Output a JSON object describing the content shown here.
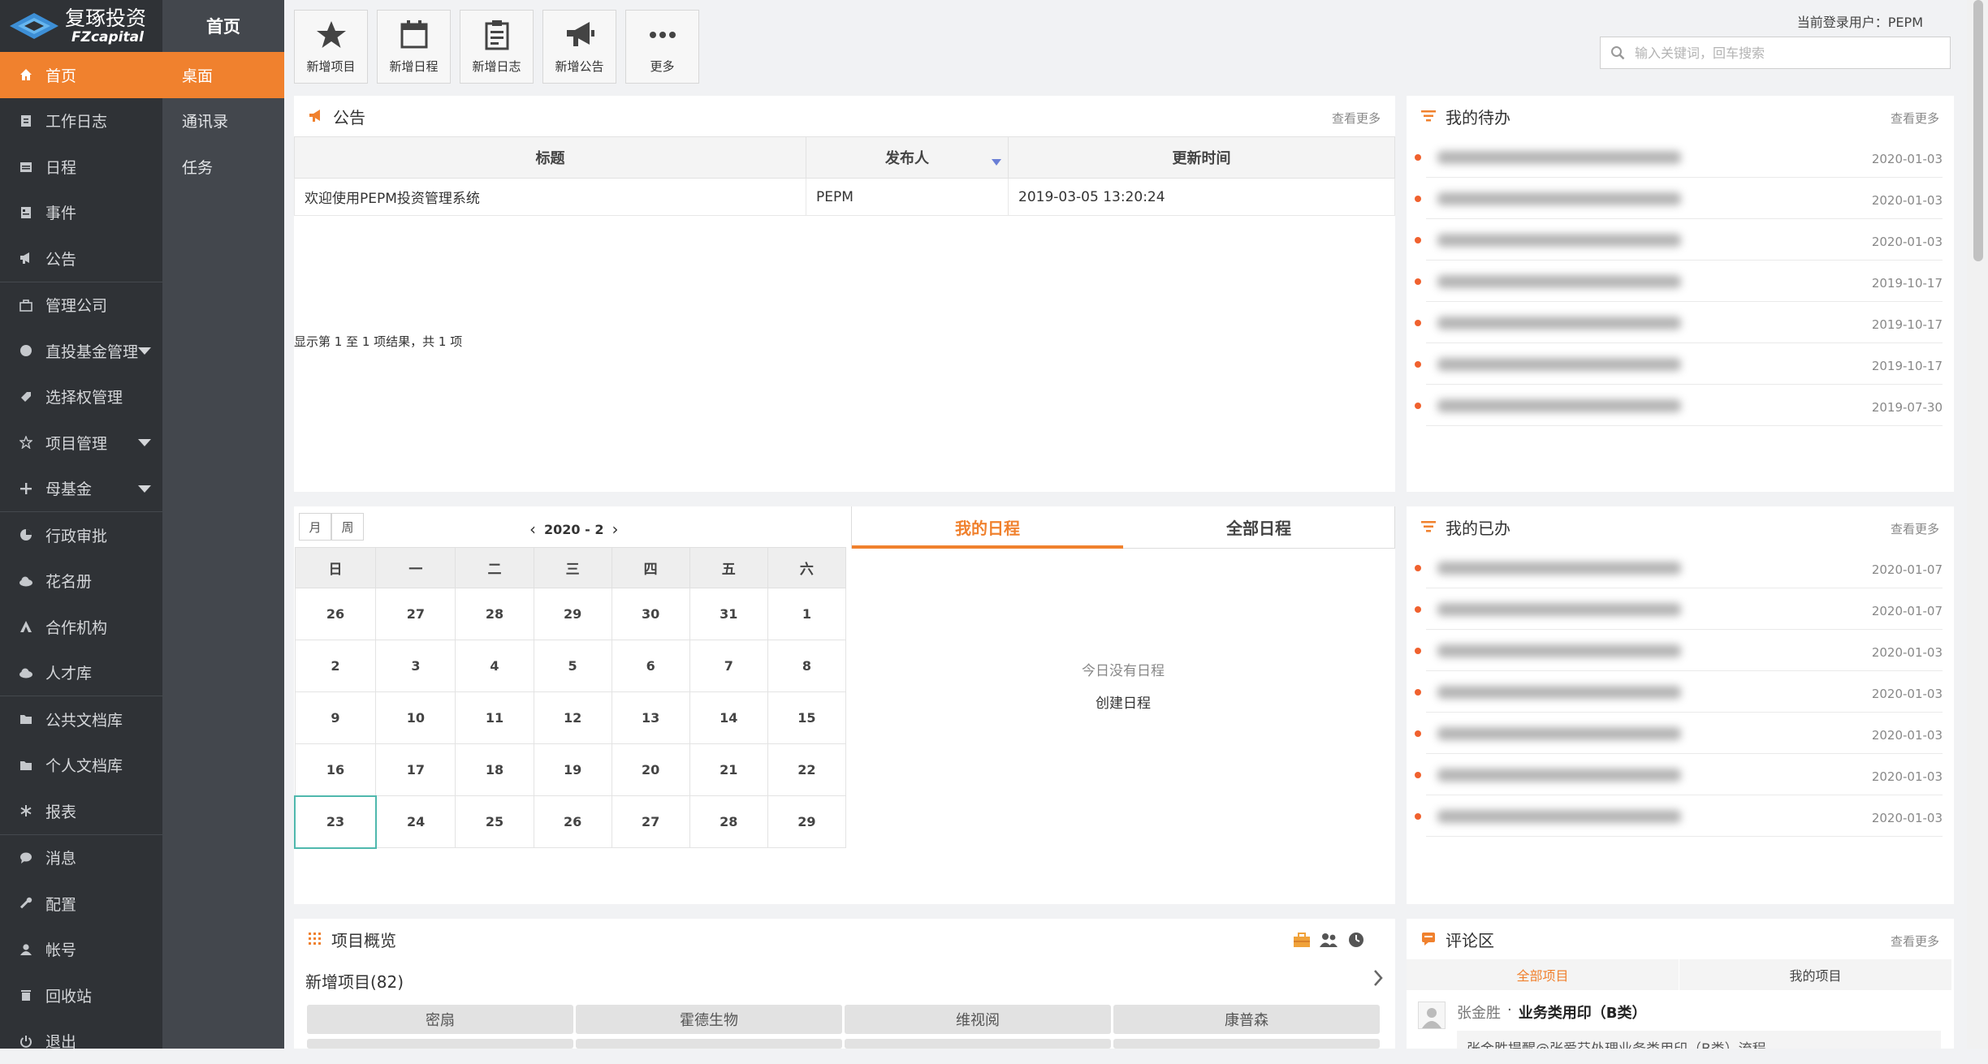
{
  "brand": {
    "name": "复琢投资",
    "sub": "FZcapital"
  },
  "sidebar": {
    "items": [
      {
        "label": "首页",
        "icon": "home-icon"
      },
      {
        "label": "工作日志",
        "icon": "document-icon"
      },
      {
        "label": "日程",
        "icon": "calendar-icon"
      },
      {
        "label": "事件",
        "icon": "event-icon"
      },
      {
        "label": "公告",
        "icon": "megaphone-icon"
      },
      {
        "label": "管理公司",
        "icon": "briefcase-icon"
      },
      {
        "label": "直投基金管理",
        "icon": "globe-icon"
      },
      {
        "label": "选择权管理",
        "icon": "tag-icon"
      },
      {
        "label": "项目管理",
        "icon": "star-icon"
      },
      {
        "label": "母基金",
        "icon": "plus-icon"
      },
      {
        "label": "行政审批",
        "icon": "pie-icon"
      },
      {
        "label": "花名册",
        "icon": "cloud-icon"
      },
      {
        "label": "合作机构",
        "icon": "partner-icon"
      },
      {
        "label": "人才库",
        "icon": "cloud-icon"
      },
      {
        "label": "公共文档库",
        "icon": "folder-icon"
      },
      {
        "label": "个人文档库",
        "icon": "folder-icon"
      },
      {
        "label": "报表",
        "icon": "asterisk-icon"
      },
      {
        "label": "消息",
        "icon": "chat-icon"
      },
      {
        "label": "配置",
        "icon": "wrench-icon"
      },
      {
        "label": "帐号",
        "icon": "user-icon"
      },
      {
        "label": "回收站",
        "icon": "trash-icon"
      },
      {
        "label": "退出",
        "icon": "power-icon"
      }
    ]
  },
  "subbar": {
    "title": "首页",
    "items": [
      "桌面",
      "通讯录",
      "任务"
    ]
  },
  "toolbar": {
    "buttons": [
      {
        "label": "新增项目",
        "icon": "star-icon"
      },
      {
        "label": "新增日程",
        "icon": "calendar-icon"
      },
      {
        "label": "新增日志",
        "icon": "clipboard-icon"
      },
      {
        "label": "新增公告",
        "icon": "megaphone-icon"
      },
      {
        "label": "更多",
        "icon": "more-icon"
      }
    ],
    "user_label": "当前登录用户：PEPM",
    "search_placeholder": "输入关键词，回车搜索"
  },
  "notice": {
    "title": "公告",
    "more": "查看更多",
    "columns": [
      "标题",
      "发布人",
      "更新时间"
    ],
    "rows": [
      {
        "title": "欢迎使用PEPM投资管理系统",
        "author": "PEPM",
        "time": "2019-03-05 13:20:24"
      }
    ],
    "info": "显示第 1 至 1 项结果，共 1 项"
  },
  "todo": {
    "title": "我的待办",
    "more": "查看更多",
    "dates": [
      "2020-01-03",
      "2020-01-03",
      "2020-01-03",
      "2019-10-17",
      "2019-10-17",
      "2019-10-17",
      "2019-07-30"
    ]
  },
  "done": {
    "title": "我的已办",
    "more": "查看更多",
    "dates": [
      "2020-01-07",
      "2020-01-07",
      "2020-01-03",
      "2020-01-03",
      "2020-01-03",
      "2020-01-03",
      "2020-01-03"
    ]
  },
  "calendar": {
    "month_btn": "月",
    "week_btn": "周",
    "period": "2020 - 2",
    "weekdays": [
      "日",
      "一",
      "二",
      "三",
      "四",
      "五",
      "六"
    ],
    "weeks": [
      [
        "26",
        "27",
        "28",
        "29",
        "30",
        "31",
        "1"
      ],
      [
        "2",
        "3",
        "4",
        "5",
        "6",
        "7",
        "8"
      ],
      [
        "9",
        "10",
        "11",
        "12",
        "13",
        "14",
        "15"
      ],
      [
        "16",
        "17",
        "18",
        "19",
        "20",
        "21",
        "22"
      ],
      [
        "23",
        "24",
        "25",
        "26",
        "27",
        "28",
        "29"
      ]
    ],
    "today": "23"
  },
  "schedule": {
    "tab_mine": "我的日程",
    "tab_all": "全部日程",
    "empty": "今日没有日程",
    "create": "创建日程"
  },
  "projects": {
    "title": "项目概览",
    "subtitle": "新增项目(82)",
    "chips": [
      "密扇",
      "霍德生物",
      "维视阅",
      "康普森"
    ]
  },
  "comments": {
    "title": "评论区",
    "more": "查看更多",
    "tab_all": "全部项目",
    "tab_mine": "我的项目",
    "author": "张金胜",
    "sep": "·",
    "subject": "业务类用印（B类）",
    "snippet": "张金胜提醒@张爱芬处理业务类用印（B类）流程"
  },
  "colors": {
    "accent": "#f0812e",
    "sidebar": "#2f3236",
    "subbar": "#43474d",
    "todo_dot": "#f0612e"
  }
}
